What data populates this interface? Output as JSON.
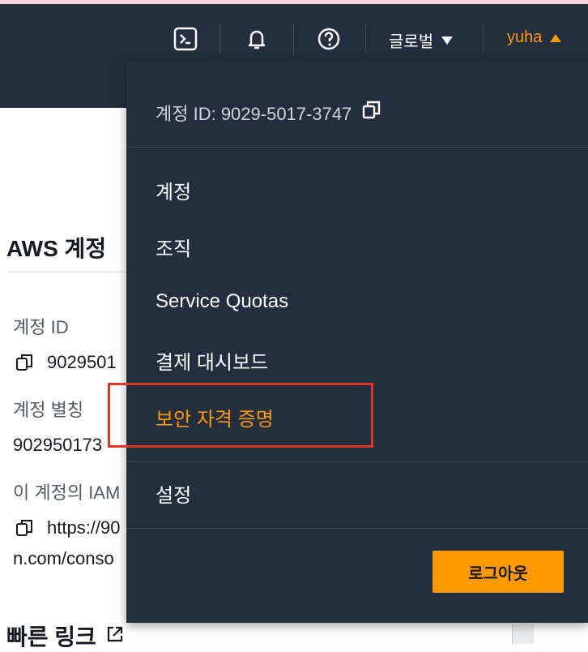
{
  "header": {
    "region_label": "글로벌",
    "user_label": "yuha",
    "icons": [
      "cloudshell-icon",
      "bell-icon",
      "help-icon"
    ]
  },
  "background": {
    "section_title": "AWS 계정",
    "account_id_label": "계정 ID",
    "account_id_value": "9029501",
    "alias_label": "계정 별칭",
    "alias_value": "902950173",
    "iam_label": "이 계정의 IAM",
    "iam_url": "https://90",
    "iam_url_cont": "n.com/conso",
    "quick_links_title": "빠른 링크"
  },
  "dropdown": {
    "account_id_text": "계정 ID: 9029-5017-3747",
    "items": [
      {
        "label": "계정"
      },
      {
        "label": "조직"
      },
      {
        "label": "Service Quotas"
      },
      {
        "label": "결제 대시보드"
      },
      {
        "label": "보안 자격 증명"
      },
      {
        "label": "설정"
      }
    ],
    "active_item": "보안 자격 증명",
    "logout_label": "로그아웃"
  },
  "colors": {
    "nav_bg": "#232f3e",
    "accent": "#ff9900",
    "highlight": "#e8352a"
  }
}
